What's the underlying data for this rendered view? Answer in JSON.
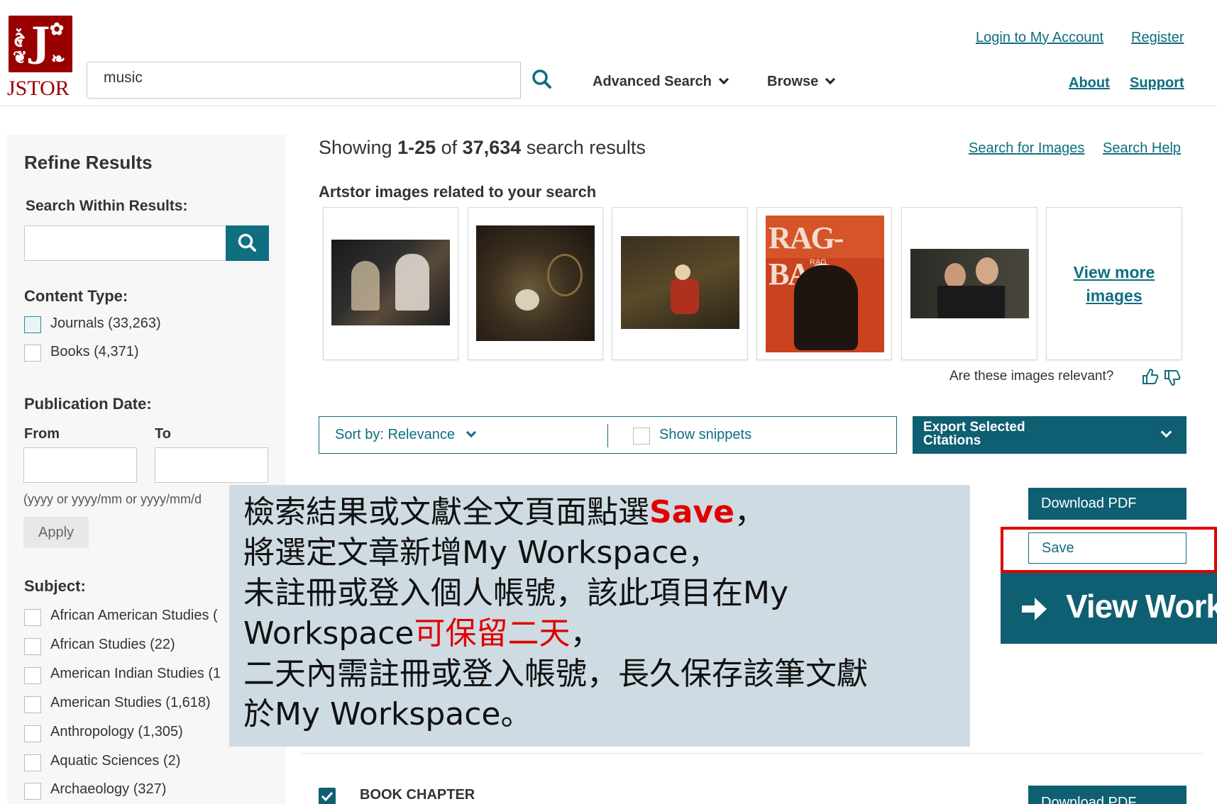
{
  "header": {
    "logo_text": "JSTOR",
    "search_value": "music",
    "nav": {
      "advanced_search": "Advanced Search",
      "browse": "Browse"
    },
    "login": "Login to My Account",
    "register": "Register",
    "about": "About",
    "support": "Support"
  },
  "sidebar": {
    "title": "Refine Results",
    "search_within_label": "Search Within Results:",
    "content_type_label": "Content Type:",
    "content_types": [
      {
        "label": "Journals (33,263)"
      },
      {
        "label": "Books (4,371)"
      }
    ],
    "pub_date_label": "Publication Date:",
    "from_label": "From",
    "to_label": "To",
    "date_hint": "(yyyy or yyyy/mm or yyyy/mm/d",
    "apply": "Apply",
    "subject_label": "Subject:",
    "subjects": [
      "African American Studies (",
      "African Studies (22)",
      "American Indian Studies (1",
      "American Studies (1,618)",
      "Anthropology (1,305)",
      "Aquatic Sciences (2)",
      "Archaeology (327)"
    ]
  },
  "results": {
    "showing_prefix": "Showing ",
    "range": "1-25",
    "of": " of ",
    "total": "37,634",
    "suffix": " search results",
    "search_images": "Search for Images",
    "search_help": "Search Help",
    "artstor_heading": "Artstor images related to your search",
    "thumb_rag_bag_text": "RAG-BAG",
    "thumb_rag_small": "RAG",
    "view_more_line1": "View more",
    "view_more_line2": "images",
    "relevant_question": "Are these images relevant?",
    "sort_label": "Sort by: Relevance",
    "show_snippets": "Show snippets",
    "export_line1": "Export Selected",
    "export_line2": "Citations",
    "download_pdf": "Download PDF",
    "save": "Save",
    "view_workspace": "View Work",
    "item_type": "BOOK CHAPTER"
  },
  "callout": {
    "line1_pre": "檢索結果或文獻全文頁面點選",
    "line1_save": "Save",
    "line1_post": "，",
    "line2": "將選定文章新增My Workspace，",
    "line3": "未註冊或登入個人帳號，該此項目在My",
    "line4_pre": "Workspace",
    "line4_red": "可保留二天",
    "line4_post": "，",
    "line5": "二天內需註冊或登入帳號，長久保存該筆文獻",
    "line6": "於My Workspace。"
  },
  "colors": {
    "jstor_red": "#990000",
    "teal": "#0f6e80",
    "callout_bg": "#cfdbe2",
    "highlight_red": "#e00000"
  }
}
